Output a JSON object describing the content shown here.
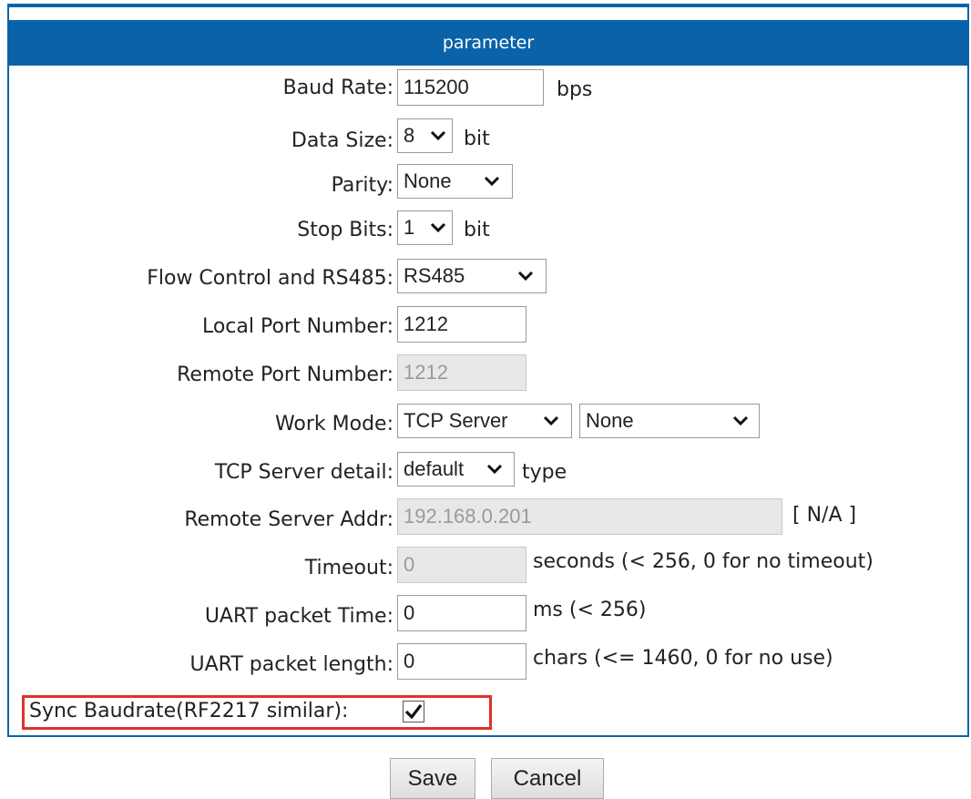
{
  "header": {
    "title": "parameter"
  },
  "fields": {
    "baud_rate": {
      "label": "Baud Rate:",
      "value": "115200",
      "unit": "bps"
    },
    "data_size": {
      "label": "Data Size:",
      "value": "8",
      "unit": "bit"
    },
    "parity": {
      "label": "Parity:",
      "value": "None"
    },
    "stop_bits": {
      "label": "Stop Bits:",
      "value": "1",
      "unit": "bit"
    },
    "flow_control": {
      "label": "Flow Control and RS485:",
      "value": "RS485"
    },
    "local_port": {
      "label": "Local Port Number:",
      "value": "1212"
    },
    "remote_port": {
      "label": "Remote Port Number:",
      "value": "1212"
    },
    "work_mode": {
      "label": "Work Mode:",
      "value": "TCP Server",
      "value2": "None"
    },
    "tcp_server_detail": {
      "label": "TCP Server detail:",
      "value": "default",
      "unit": "type"
    },
    "remote_server_addr": {
      "label": "Remote Server Addr:",
      "value": "192.168.0.201",
      "note": "[ N/A ]"
    },
    "timeout": {
      "label": "Timeout:",
      "value": "0",
      "unit": "seconds (< 256, 0 for no timeout)"
    },
    "uart_packet_time": {
      "label": "UART packet Time:",
      "value": "0",
      "unit": "ms (< 256)"
    },
    "uart_packet_length": {
      "label": "UART packet length:",
      "value": "0",
      "unit": "chars (<= 1460, 0 for no use)"
    },
    "sync_baudrate": {
      "label": "Sync Baudrate(RF2217 similar):",
      "checked": true
    }
  },
  "buttons": {
    "save": "Save",
    "cancel": "Cancel"
  },
  "colors": {
    "header_bg": "#0a63a8",
    "highlight": "#e0312b"
  },
  "icons": {
    "select_arrow": "chevron-down-icon",
    "check": "checkmark-icon"
  }
}
